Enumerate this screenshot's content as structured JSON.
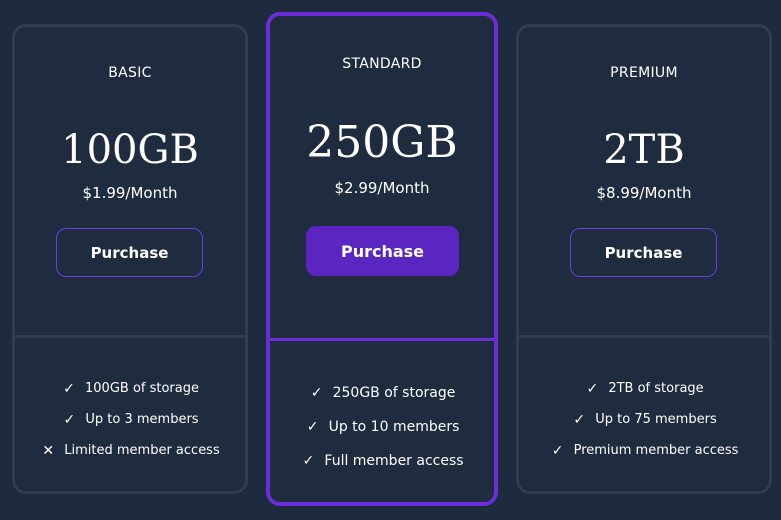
{
  "plans": [
    {
      "name": "BASIC",
      "storage": "100GB",
      "price": "$1.99/Month",
      "button_label": "Purchase",
      "features": [
        {
          "mark": "✓",
          "text": "100GB of storage"
        },
        {
          "mark": "✓",
          "text": "Up to 3 members"
        },
        {
          "mark": "✕",
          "text": "Limited member access"
        }
      ]
    },
    {
      "name": "STANDARD",
      "storage": "250GB",
      "price": "$2.99/Month",
      "button_label": "Purchase",
      "features": [
        {
          "mark": "✓",
          "text": "250GB of storage"
        },
        {
          "mark": "✓",
          "text": "Up to 10 members"
        },
        {
          "mark": "✓",
          "text": "Full member access"
        }
      ]
    },
    {
      "name": "PREMIUM",
      "storage": "2TB",
      "price": "$8.99/Month",
      "button_label": "Purchase",
      "features": [
        {
          "mark": "✓",
          "text": "2TB of storage"
        },
        {
          "mark": "✓",
          "text": "Up to 75 members"
        },
        {
          "mark": "✓",
          "text": "Premium member access"
        }
      ]
    }
  ],
  "icons": {
    "included": "check-icon",
    "excluded": "cross-icon"
  },
  "colors": {
    "background": "#1e2a3d",
    "card_border": "#2f3d51",
    "accent": "#6a2dd8",
    "button_fill": "#5b25c2"
  }
}
